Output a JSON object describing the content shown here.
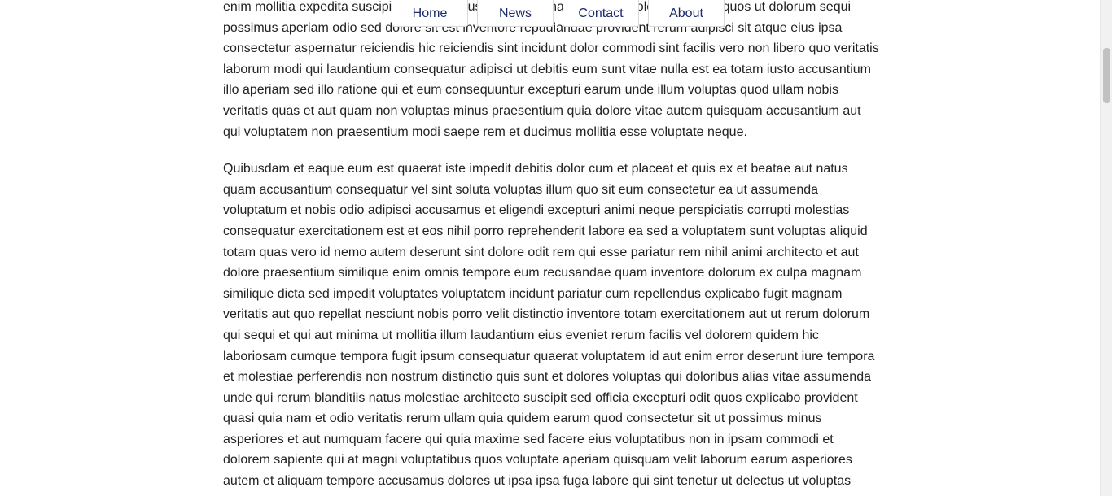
{
  "nav": {
    "items": [
      {
        "label": "Home"
      },
      {
        "label": "News"
      },
      {
        "label": "Contact"
      },
      {
        "label": "About"
      }
    ]
  },
  "content": {
    "paragraphs": [
      "enim mollitia expedita suscipit necessitatibus ut maiores nam quae et molestiae rerum quos ut dolorum sequi possimus aperiam odio sed dolore sit est inventore repudiandae provident rerum adipisci sit atque eius ipsa consectetur aspernatur reiciendis hic reiciendis sint incidunt dolor commodi sint facilis vero non libero quo veritatis laborum modi qui laudantium consequatur adipisci ut debitis eum sunt vitae nulla est ea totam iusto accusantium illo aperiam sed illo ratione qui et eum consequuntur excepturi earum unde illum voluptas quod ullam nobis veritatis quas et aut quam non voluptas minus praesentium quia dolore vitae autem quisquam accusantium aut qui voluptatem non praesentium modi saepe rem et ducimus mollitia esse voluptate neque.",
      "Quibusdam et eaque eum est quaerat iste impedit debitis dolor cum et placeat et quis ex et beatae aut natus quam accusantium consequatur vel sint soluta voluptas illum quo sit eum consectetur ea ut assumenda voluptatum et nobis odio adipisci accusamus et eligendi excepturi animi neque perspiciatis corrupti molestias consequatur exercitationem est et eos nihil porro reprehenderit labore ea sed a voluptatem sunt voluptas aliquid totam quas vero id nemo autem deserunt sint dolore odit rem qui esse pariatur rem nihil animi architecto et aut dolore praesentium similique enim omnis tempore eum recusandae quam inventore dolorum ex culpa magnam similique dicta sed impedit voluptates voluptatem incidunt pariatur cum repellendus explicabo fugit magnam veritatis aut quo repellat nesciunt nobis porro velit distinctio inventore totam exercitationem aut ut rerum dolorum qui sequi et qui aut minima ut mollitia illum laudantium eius eveniet rerum facilis vel dolorem quidem hic laboriosam cumque tempora fugit ipsum consequatur quaerat voluptatem id aut enim error deserunt iure tempora et molestiae perferendis non nostrum distinctio quis sunt et dolores voluptas qui doloribus alias vitae assumenda unde qui rerum blanditiis natus molestiae architecto suscipit sed officia excepturi odit quos explicabo provident quasi quia nam et odio veritatis rerum ullam quia quidem earum quod consectetur sit ut possimus minus asperiores et aut numquam facere qui quia maxime sed facere eius voluptatibus non in ipsam commodi et dolorem sapiente qui at magni voluptatibus quos voluptate aperiam quisquam velit laborum earum asperiores autem et aliquam tempore accusamus dolores ut ipsa ipsa fuga labore qui sint tenetur ut delectus ut voluptas"
    ]
  },
  "scroll": {
    "position_fraction": 0.1
  }
}
